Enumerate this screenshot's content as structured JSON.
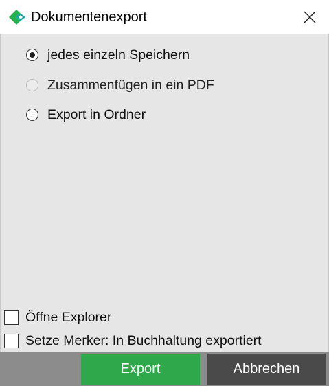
{
  "window": {
    "title": "Dokumentenexport",
    "icon": "app-logo-icon",
    "close_icon": "close-icon"
  },
  "options": [
    {
      "label": "jedes einzeln Speichern",
      "selected": true,
      "enabled": true
    },
    {
      "label": "Zusammenfügen in ein PDF",
      "selected": false,
      "enabled": false
    },
    {
      "label": "Export in Ordner",
      "selected": false,
      "enabled": true
    }
  ],
  "checkboxes": [
    {
      "label": "Öffne Explorer",
      "checked": false
    },
    {
      "label": "Setze Merker: In Buchhaltung exportiert",
      "checked": false
    }
  ],
  "buttons": {
    "export_label": "Export",
    "cancel_label": "Abbrechen"
  },
  "colors": {
    "export_button": "#2ea84a",
    "cancel_button": "#4a4a4a",
    "content_background": "#e6e6e6",
    "footer_background": "#8c8c8c",
    "logo_green": "#22b14c",
    "logo_teal": "#1aa3a3"
  }
}
